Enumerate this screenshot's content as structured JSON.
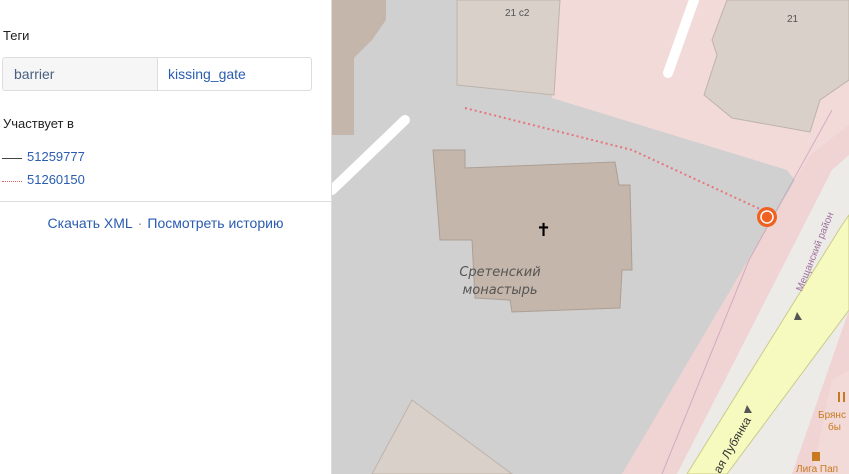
{
  "sidebar": {
    "tags_title": "Теги",
    "tags": [
      {
        "key": "barrier",
        "value": "kissing_gate"
      }
    ],
    "relations_title": "Участвует в",
    "relations": [
      {
        "id": "51259777",
        "style": "solid"
      },
      {
        "id": "51260150",
        "style": "dotted"
      }
    ],
    "links": {
      "download_xml": "Скачать XML",
      "separator": "·",
      "view_history": "Посмотреть историю"
    }
  },
  "map": {
    "house_numbers": [
      "21 с2",
      "21"
    ],
    "cross_symbol": "✝",
    "place_label_line1": "Сретенский",
    "place_label_line2": "монастырь",
    "district_label": "Мещанский район",
    "street_label": "ая Лубянка",
    "poi_labels": [
      "Брянс",
      "бы",
      "Лига Пап"
    ],
    "marker_icon": "gate-marker-icon",
    "colors": {
      "map_background": "#d0d0d0",
      "building": "#d9d0c9",
      "monastery": "#c4b6ab",
      "pedestrian_area": "#f2dad9",
      "path_dotted": "#e8747a",
      "marker": "#f06020",
      "road_yellow": "#f7fabf",
      "link_blue": "#2a5db0"
    }
  }
}
